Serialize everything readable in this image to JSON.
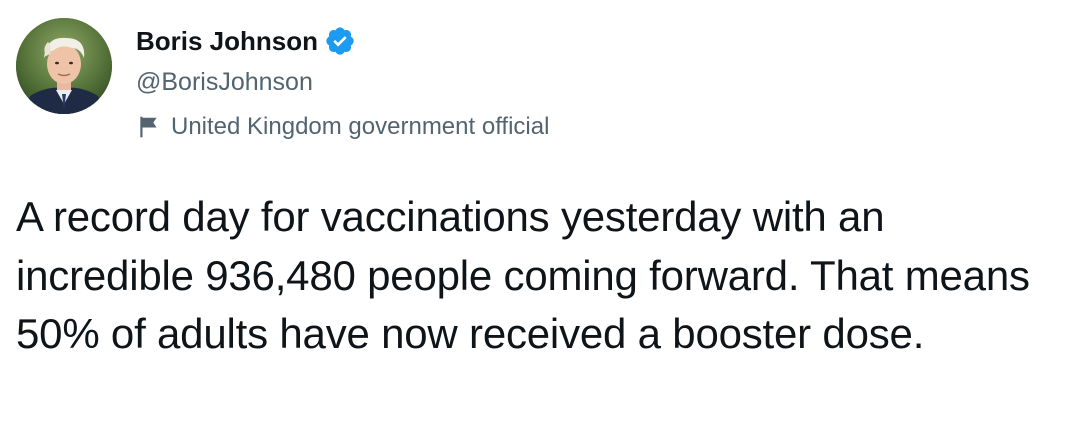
{
  "author": {
    "display_name": "Boris Johnson",
    "handle": "@BorisJohnson",
    "verified": true,
    "label": "United Kingdom government official"
  },
  "tweet": {
    "text": "A record day for vaccinations yesterday with an incredible 936,480 people coming forward. That means 50% of adults have now received a booster dose."
  },
  "icons": {
    "verified": "verified-badge-icon",
    "label": "flag-icon",
    "avatar": "profile-photo"
  },
  "colors": {
    "text_primary": "#0f1419",
    "text_secondary": "#536471",
    "verified_blue": "#1d9bf0",
    "background": "#ffffff"
  }
}
